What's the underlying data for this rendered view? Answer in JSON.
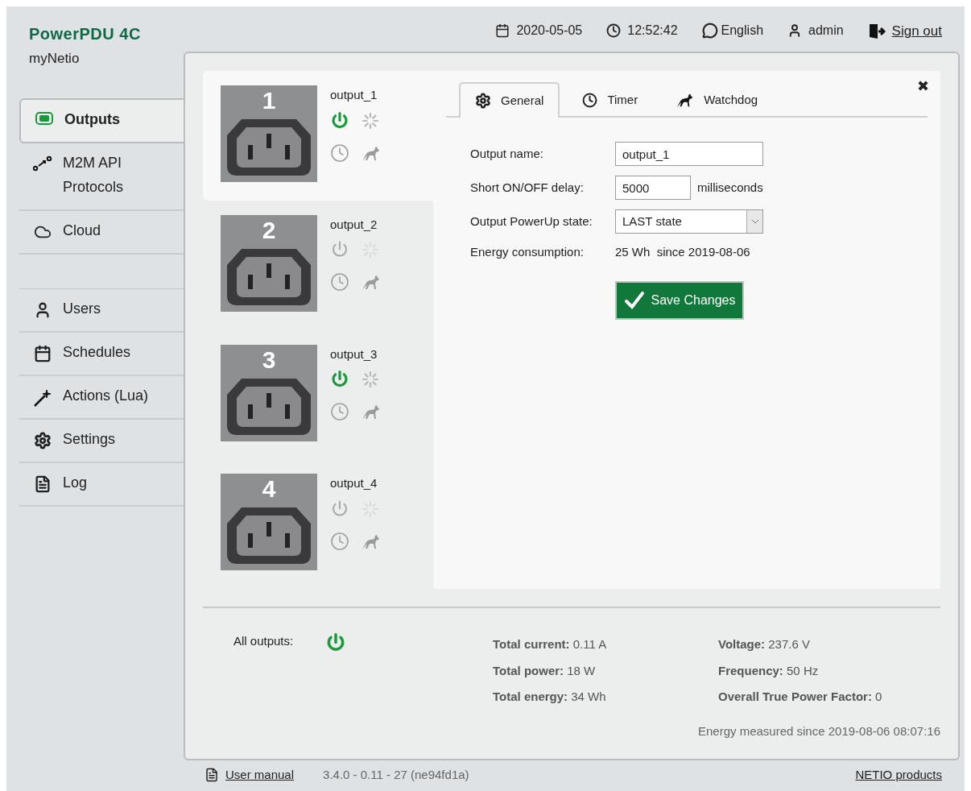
{
  "brand": {
    "logo": "PowerPDU 4C",
    "subtitle": "myNetio"
  },
  "header": {
    "date": "2020-05-05",
    "time": "12:52:42",
    "language": "English",
    "user": "admin",
    "sign_out": "Sign out"
  },
  "sidebar": {
    "sections": [
      [
        {
          "label": "Outputs",
          "selected": true
        },
        {
          "label": "M2M API\nProtocols",
          "selected": false
        },
        {
          "label": "Cloud",
          "selected": false
        }
      ],
      [
        {
          "label": "Users",
          "selected": false
        },
        {
          "label": "Schedules",
          "selected": false
        },
        {
          "label": "Actions (Lua)",
          "selected": false
        },
        {
          "label": "Settings",
          "selected": false
        },
        {
          "label": "Log",
          "selected": false
        }
      ]
    ]
  },
  "outputs": [
    {
      "number": "1",
      "name": "output_1",
      "on": true,
      "selected": true
    },
    {
      "number": "2",
      "name": "output_2",
      "on": false,
      "selected": false
    },
    {
      "number": "3",
      "name": "output_3",
      "on": true,
      "selected": false
    },
    {
      "number": "4",
      "name": "output_4",
      "on": false,
      "selected": false
    }
  ],
  "detail": {
    "close": "✖",
    "tabs": [
      {
        "label": "General",
        "selected": true
      },
      {
        "label": "Timer",
        "selected": false
      },
      {
        "label": "Watchdog",
        "selected": false
      }
    ],
    "output_name_label": "Output name:",
    "output_name": "output_1",
    "delay_label": "Short ON/OFF delay:",
    "delay": "5000",
    "delay_unit": "milliseconds",
    "powerup_label": "Output PowerUp state:",
    "powerup": "LAST state",
    "energy_label": "Energy consumption:",
    "energy": "25 Wh  since 2019-08-06",
    "save": "Save Changes"
  },
  "summary": {
    "all_outputs_label": "All outputs:",
    "all_on": true,
    "totals": [
      "**Total current:** 0.11 A",
      "**Total power:** 18 W",
      "**Total energy:** 34 Wh"
    ],
    "grid": [
      "**Voltage:** 237.6 V",
      "**Frequency:** 50 Hz",
      "**Overall True Power Factor:** 0"
    ],
    "measured_since": "Energy measured since 2019-08-06 08:07:16"
  },
  "footer": {
    "manual": "User manual",
    "version": "3.4.0 - 0.11 - 27 (ne94fd1a)",
    "products": "NETIO products"
  }
}
